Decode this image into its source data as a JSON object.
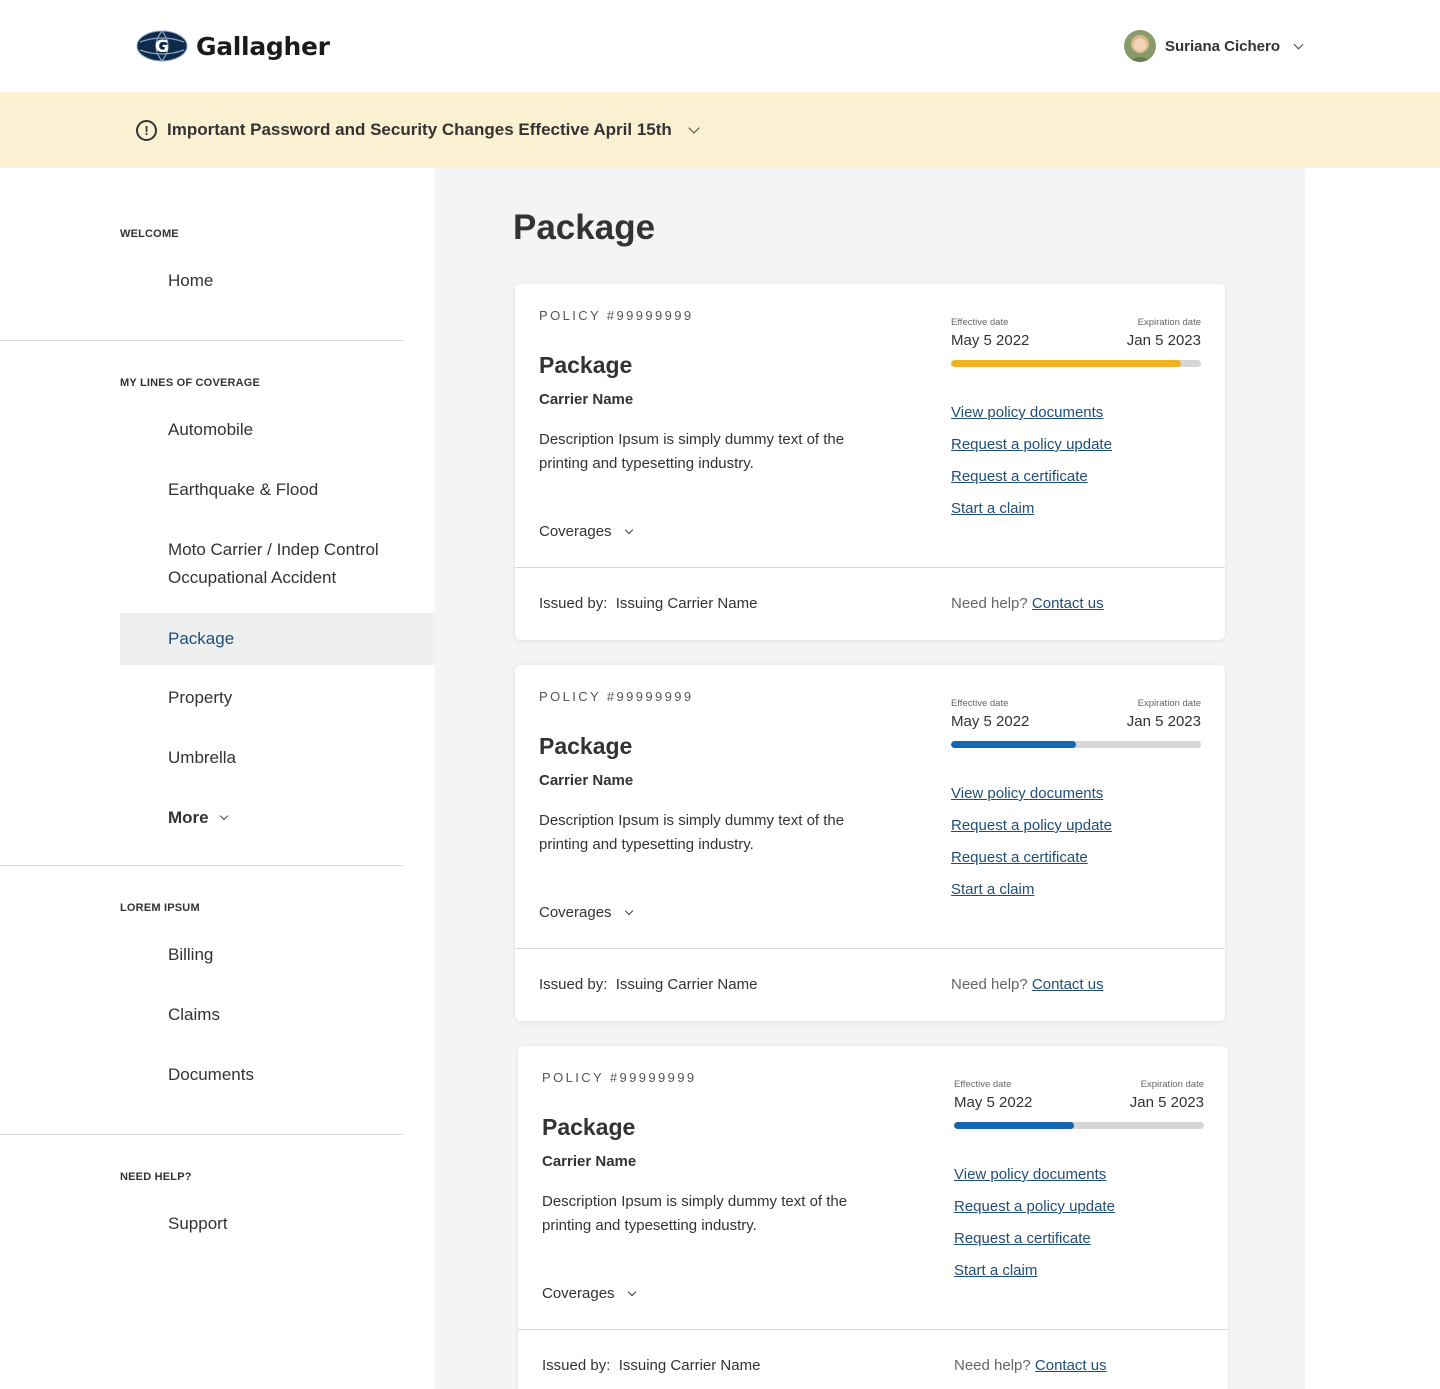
{
  "header": {
    "logo_text": "Gallagher",
    "user_name": "Suriana Cichero"
  },
  "banner": {
    "icon": "!",
    "text": "Important Password and Security Changes Effective April 15th"
  },
  "sidebar": {
    "sections": [
      {
        "title": "WELCOME",
        "items": [
          "Home"
        ]
      },
      {
        "title": "MY LINES OF COVERAGE",
        "items": [
          "Automobile",
          "Earthquake & Flood",
          "Moto Carrier / Indep Control",
          "Occupational Accident",
          "Package",
          "Property",
          "Umbrella",
          "More"
        ]
      },
      {
        "title": "LOREM IPSUM",
        "items": [
          "Billing",
          "Claims",
          "Documents"
        ]
      },
      {
        "title": "NEED HELP?",
        "items": [
          "Support"
        ]
      }
    ],
    "active_item": "Package"
  },
  "main": {
    "title": "Package",
    "policies": [
      {
        "policy_number": "POLICY #99999999",
        "title": "Package",
        "carrier": "Carrier Name",
        "description": "Description Ipsum is simply dummy text of the printing and typesetting industry.",
        "coverages_label": "Coverages",
        "effective_label": "Effective date",
        "expiration_label": "Expiration date",
        "effective_date": "May 5 2022",
        "expiration_date": "Jan 5 2023",
        "progress": 0.92,
        "progress_color": "#f0b323",
        "links": [
          "View policy documents",
          "Request a policy update",
          "Request a certificate",
          "Start a claim"
        ],
        "issued_by_label": "Issued by:",
        "issuer": "Issuing Carrier Name",
        "help_text": "Need help?",
        "contact_label": "Contact us"
      },
      {
        "policy_number": "POLICY #99999999",
        "title": "Package",
        "carrier": "Carrier Name",
        "description": "Description Ipsum is simply dummy text of the printing and typesetting industry.",
        "coverages_label": "Coverages",
        "effective_label": "Effective date",
        "expiration_label": "Expiration date",
        "effective_date": "May 5 2022",
        "expiration_date": "Jan 5 2023",
        "progress": 0.5,
        "progress_color": "#1466b0",
        "links": [
          "View policy documents",
          "Request a policy update",
          "Request a certificate",
          "Start a claim"
        ],
        "issued_by_label": "Issued by:",
        "issuer": "Issuing Carrier Name",
        "help_text": "Need help?",
        "contact_label": "Contact us"
      },
      {
        "policy_number": "POLICY #99999999",
        "title": "Package",
        "carrier": "Carrier Name",
        "description": "Description Ipsum is simply dummy text of the printing and typesetting industry.",
        "coverages_label": "Coverages",
        "effective_label": "Effective date",
        "expiration_label": "Expiration date",
        "effective_date": "May 5 2022",
        "expiration_date": "Jan 5 2023",
        "progress": 0.48,
        "progress_color": "#1466b0",
        "links": [
          "View policy documents",
          "Request a policy update",
          "Request a certificate",
          "Start a claim"
        ],
        "issued_by_label": "Issued by:",
        "issuer": "Issuing Carrier Name",
        "help_text": "Need help?",
        "contact_label": "Contact us"
      }
    ]
  }
}
